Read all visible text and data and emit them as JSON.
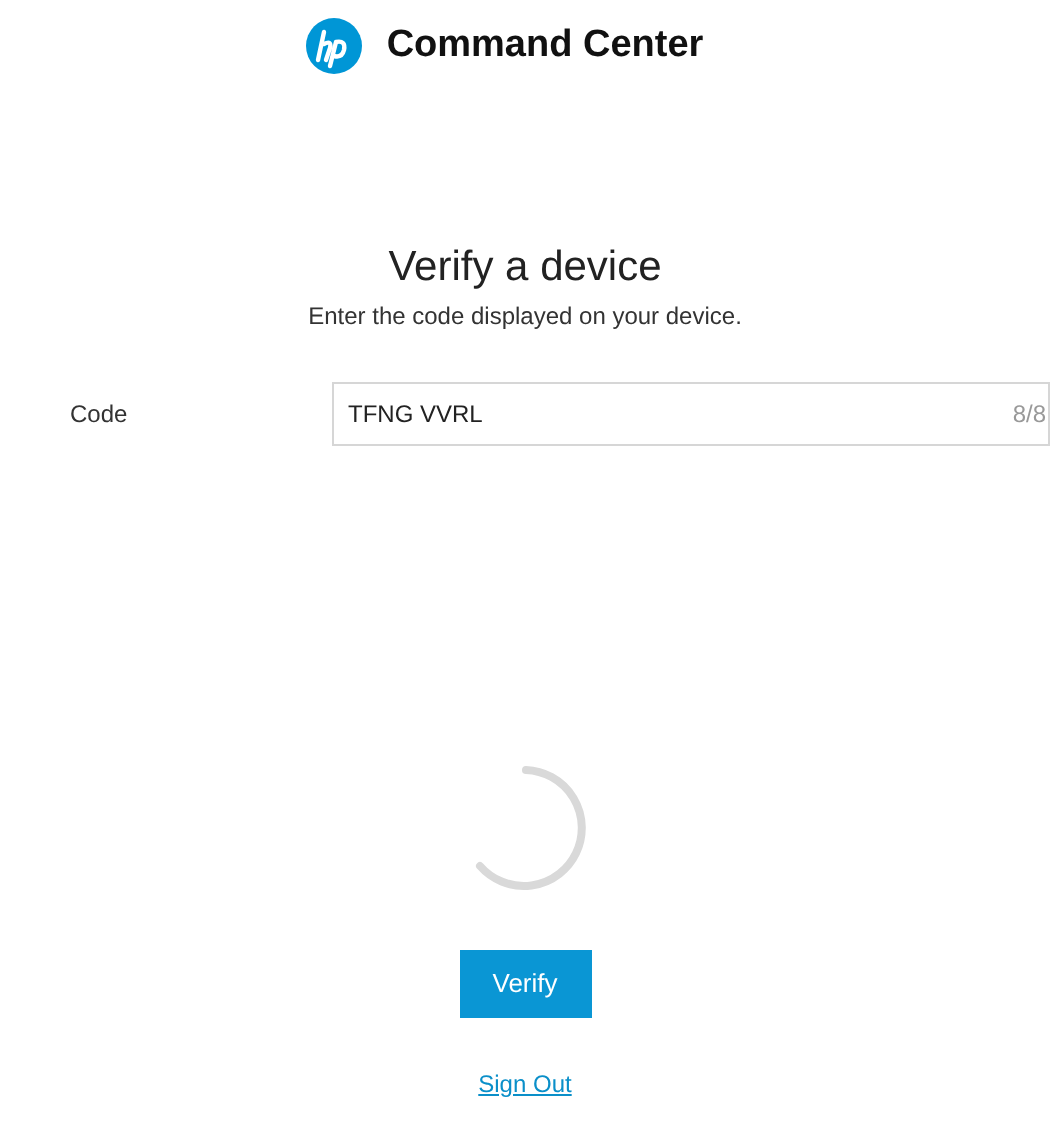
{
  "header": {
    "title": "Command Center"
  },
  "heading": "Verify a device",
  "subtitle": "Enter the code displayed on your device.",
  "code_field": {
    "label": "Code",
    "value": "TFNG VVRL",
    "counter": "8/8"
  },
  "loading": true,
  "verify_button": "Verify",
  "sign_out_link": "Sign Out"
}
